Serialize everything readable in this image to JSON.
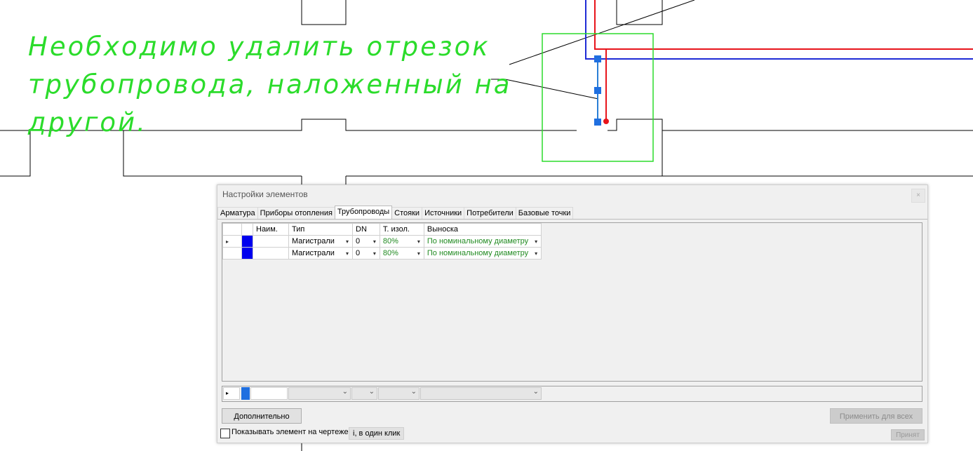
{
  "annotation": {
    "lines": [
      "Необходимо удалить отрезок",
      "трубопровода, наложенный на",
      "другой."
    ]
  },
  "colors": {
    "annotation": "#2bdc2b",
    "pipe_red": "#e8141b",
    "pipe_blue": "#1f2bd6",
    "riser_blue": "#2a7fd6",
    "grip": "#1f6fe0",
    "selection_frame": "#2bdc2b"
  },
  "dialog": {
    "title": "Настройки элементов",
    "close": "×",
    "tabs": [
      "Арматура",
      "Приборы отопления",
      "Трубопроводы",
      "Стояки",
      "Источники",
      "Потребители",
      "Базовые точки"
    ],
    "active_tab": "Трубопроводы",
    "grid": {
      "headers": [
        "",
        "",
        "Наим.",
        "Тип",
        "DN",
        "",
        "Т. изол.",
        "",
        "Выноска",
        ""
      ],
      "rows": [
        {
          "marker": "▸",
          "name": "",
          "type": "Магистрали",
          "dn": "0",
          "insulation": "80%",
          "callout": "По номинальному диаметру"
        },
        {
          "marker": "",
          "name": "",
          "type": "Магистрали",
          "dn": "0",
          "insulation": "80%",
          "callout": "По номинальному диаметру"
        }
      ],
      "dropdown_glyph": "▾"
    },
    "new_row_marker": "▸",
    "chevron": "⌄",
    "buttons": {
      "more": "Дополнительно",
      "apply_all": "Применить для всех",
      "accept": "Принят"
    },
    "show_in_drawing": {
      "label": "Показывать элемент на чертеже",
      "checked": false
    },
    "one_click": "і, в один клик"
  }
}
